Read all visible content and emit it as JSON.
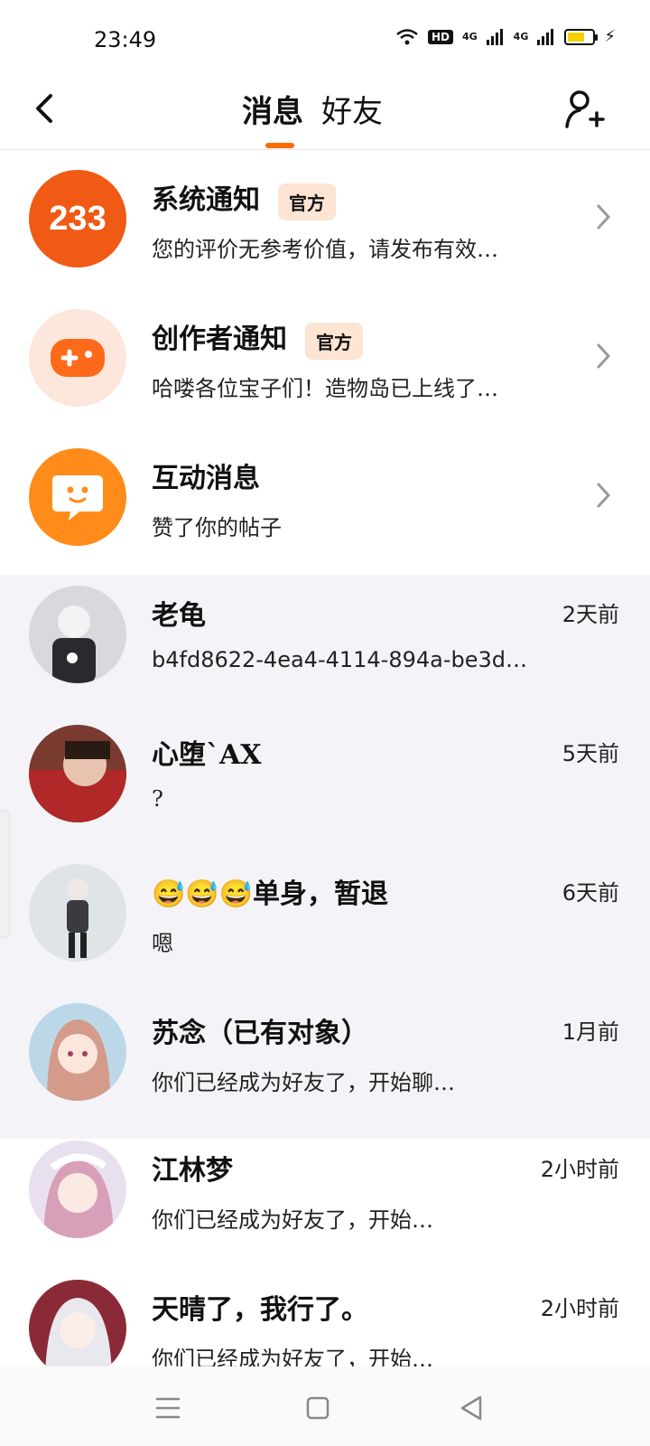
{
  "status": {
    "time": "23:49",
    "signal1": "4G",
    "signal2": "4G",
    "hd": "HD",
    "battery_level": 0.7
  },
  "header": {
    "tabs": [
      "消息",
      "好友"
    ],
    "active_tab": "消息"
  },
  "system_rows": [
    {
      "title": "系统通知",
      "badge": "官方",
      "subtitle": "您的评价无参考价值，请发布有效…",
      "avatar_text": "233",
      "color": "#f05a14"
    },
    {
      "title": "创作者通知",
      "badge": "官方",
      "subtitle": "哈喽各位宝子们！造物岛已上线了…",
      "color": "#ff7a2a"
    },
    {
      "title": "互动消息",
      "subtitle": "赞了你的帖子",
      "color": "#ff8c1a"
    }
  ],
  "chats": [
    {
      "name": "老龟",
      "preview": "b4fd8622-4ea4-4114-894a-be3d…",
      "time": "2天前",
      "avatar_color": "#c8c8d0"
    },
    {
      "name": "心堕`AX",
      "preview": "?",
      "time": "5天前",
      "avatar_color": "#8a4a3a"
    },
    {
      "name": "😅😅😅单身，暂退",
      "preview": "嗯",
      "time": "6天前",
      "avatar_color": "#dde2e6"
    },
    {
      "name": "苏念（已有对象）",
      "preview": "你们已经成为好友了，开始聊…",
      "time": "1月前",
      "avatar_color": "#e8b8b0"
    },
    {
      "name": "江林梦",
      "preview": "你们已经成为好友了，开始…",
      "time": "2小时前",
      "avatar_color": "#e0c4d4"
    },
    {
      "name": "天晴了，我行了。",
      "preview": "你们已经成为好友了，开始…",
      "time": "2小时前",
      "avatar_color": "#9a3040"
    }
  ]
}
